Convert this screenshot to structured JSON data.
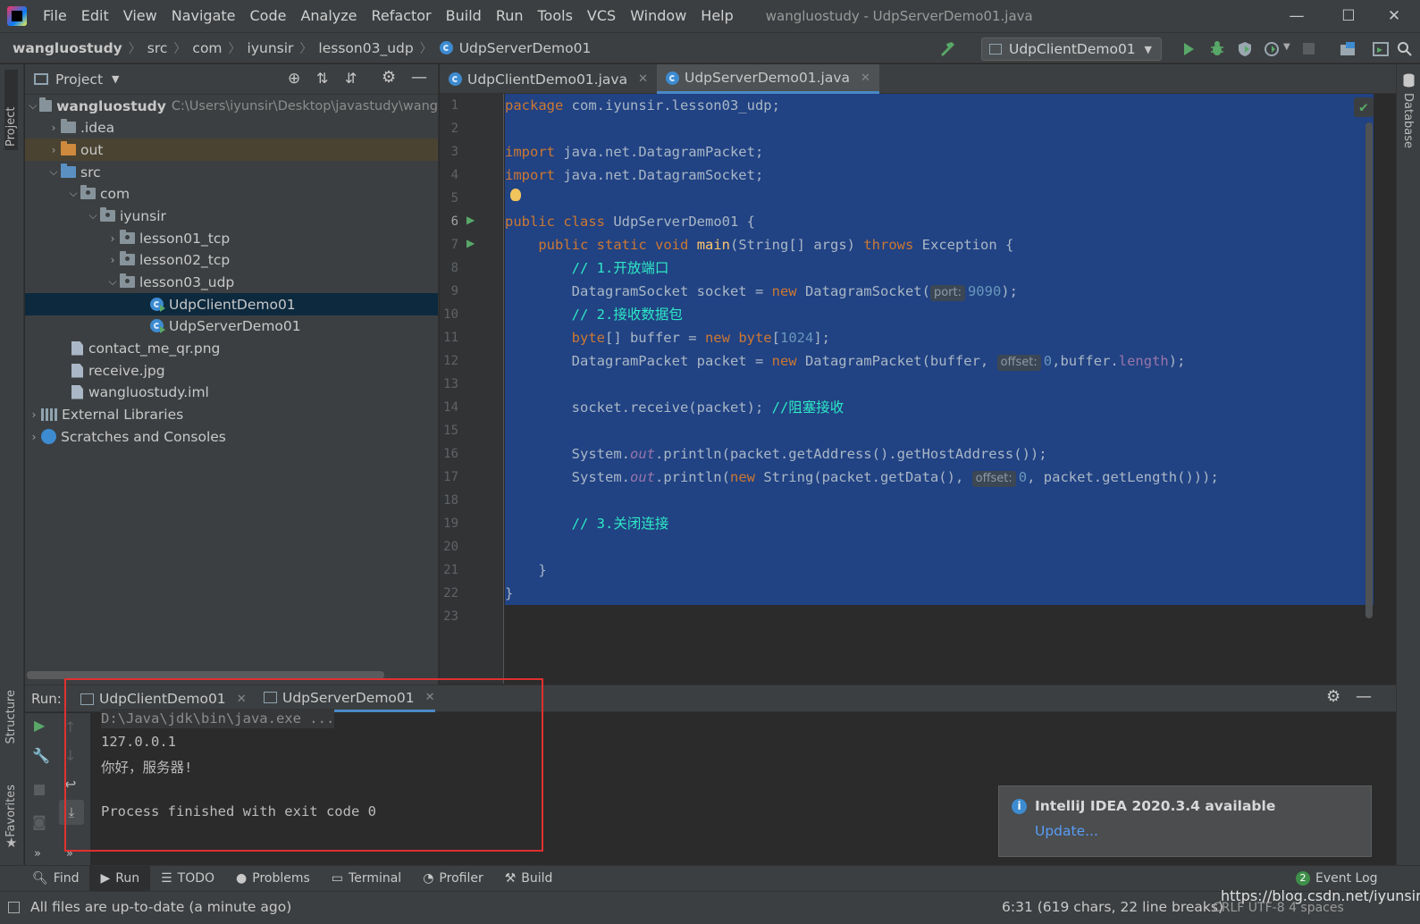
{
  "menu": [
    "File",
    "Edit",
    "View",
    "Navigate",
    "Code",
    "Analyze",
    "Refactor",
    "Build",
    "Run",
    "Tools",
    "VCS",
    "Window",
    "Help"
  ],
  "window_title": "wangluostudy - UdpServerDemo01.java",
  "breadcrumb": [
    "wangluostudy",
    "src",
    "com",
    "iyunsir",
    "lesson03_udp",
    "UdpServerDemo01"
  ],
  "run_config": "UdpClientDemo01",
  "project_panel": {
    "title": "Project",
    "tree": [
      {
        "label": "wangluostudy",
        "path": "C:\\Users\\iyunsir\\Desktop\\javastudy\\wang"
      },
      {
        "label": ".idea"
      },
      {
        "label": "out"
      },
      {
        "label": "src"
      },
      {
        "label": "com"
      },
      {
        "label": "iyunsir"
      },
      {
        "label": "lesson01_tcp"
      },
      {
        "label": "lesson02_tcp"
      },
      {
        "label": "lesson03_udp"
      },
      {
        "label": "UdpClientDemo01"
      },
      {
        "label": "UdpServerDemo01"
      },
      {
        "label": "contact_me_qr.png"
      },
      {
        "label": "receive.jpg"
      },
      {
        "label": "wangluostudy.iml"
      },
      {
        "label": "External Libraries"
      },
      {
        "label": "Scratches and Consoles"
      }
    ]
  },
  "editor_tabs": [
    "UdpClientDemo01.java",
    "UdpServerDemo01.java"
  ],
  "hints": {
    "port": "port:",
    "offset": "offset:"
  },
  "code": {
    "l1_kw": "package",
    "l1_rest": " com.iyunsir.lesson03_udp;",
    "import": "import",
    "l3_rest": " java.net.DatagramPacket;",
    "l4_rest": " java.net.DatagramSocket;",
    "public": "public",
    "class": "class",
    "static": "static",
    "void": "void",
    "throws": "throws",
    "new": "new",
    "byte": "byte",
    "l6_name": " UdpServerDemo01 {",
    "main": "main",
    "l7_params": "(String[] args) ",
    "l7_exc": " Exception {",
    "c1": "// 1.开放端口",
    "l9_a": "DatagramSocket socket = ",
    "l9_b": " DatagramSocket(",
    "l9_num": "9090",
    "l9_end": ");",
    "c2": "// 2.接收数据包",
    "l11_a": "[] buffer = ",
    "l11_b": "[",
    "l11_num": "1024",
    "l11_end": "];",
    "l12_a": "DatagramPacket packet = ",
    "l12_b": " DatagramPacket(buffer, ",
    "l12_num": "0",
    "l12_c": ",buffer.",
    "l12_fld": "length",
    "l12_end": ");",
    "l14": "socket.receive(packet); ",
    "c3": "//阻塞接收",
    "sys": "System.",
    "out": "out",
    "l16_rest": ".println(packet.getAddress().getHostAddress());",
    "l17_a": ".println(",
    "l17_b": " String(packet.getData(), ",
    "l17_num": "0",
    "l17_c": ", packet.getLength()));",
    "c4": "// 3.关闭连接",
    "brace": "}"
  },
  "run": {
    "label": "Run:",
    "tabs": [
      "UdpClientDemo01",
      "UdpServerDemo01"
    ],
    "console": [
      "D:\\Java\\jdk\\bin\\java.exe ...",
      "127.0.0.1",
      "你好，服务器!",
      "",
      "Process finished with exit code 0"
    ]
  },
  "notification": {
    "title": "IntelliJ IDEA 2020.3.4 available",
    "link": "Update..."
  },
  "bottom_tools": [
    "Find",
    "Run",
    "TODO",
    "Problems",
    "Terminal",
    "Profiler",
    "Build"
  ],
  "event_log": {
    "count": "2",
    "label": "Event Log"
  },
  "status": {
    "message": "All files are up-to-date (a minute ago)",
    "position": "6:31 (619 chars, 22 line breaks)",
    "encoding": "CRLF   UTF-8   4 spaces",
    "watermark": "https://blog.csdn.net/iyunsir"
  },
  "left_strip": [
    "Project",
    "Structure",
    "Favorites"
  ],
  "right_strip": [
    "Database"
  ],
  "colors": {
    "accent": "#4a88c7",
    "selection": "#214283",
    "keyword": "#cc7832",
    "comment": "#2ee8c6",
    "number": "#6897bb",
    "highlight_box": "#e03030"
  }
}
